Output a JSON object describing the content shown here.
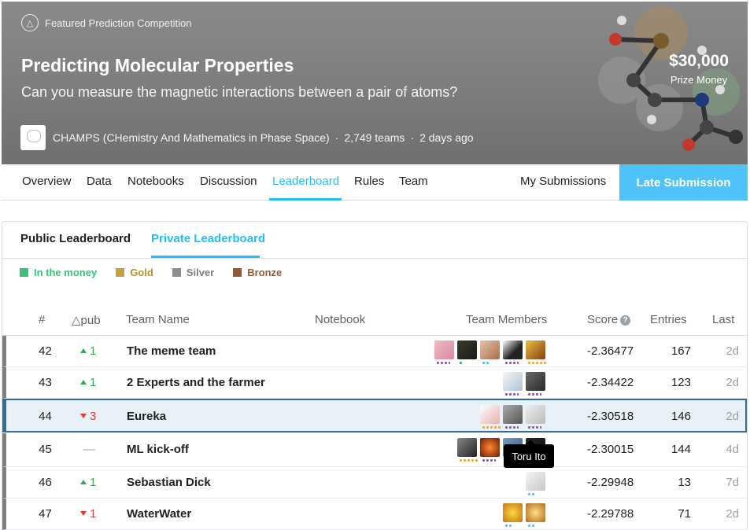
{
  "hero": {
    "label": "Featured Prediction Competition",
    "title": "Predicting Molecular Properties",
    "subtitle": "Can you measure the magnetic interactions between a pair of atoms?",
    "host": "CHAMPS (CHemistry And Mathematics in Phase Space)",
    "teams": "2,749 teams",
    "time": "2 days ago",
    "separator": "·",
    "prize_amount": "$30,000",
    "prize_label": "Prize Money"
  },
  "tabs": [
    "Overview",
    "Data",
    "Notebooks",
    "Discussion",
    "Leaderboard",
    "Rules",
    "Team"
  ],
  "my_submissions": "My Submissions",
  "late_submission": "Late Submission",
  "leaderboard": {
    "public_tab": "Public Leaderboard",
    "private_tab": "Private Leaderboard",
    "legend": [
      {
        "label": "In the money",
        "color": "#3cc07a"
      },
      {
        "label": "Gold",
        "color": "#c9a03c"
      },
      {
        "label": "Silver",
        "color": "#8e8e8e"
      },
      {
        "label": "Bronze",
        "color": "#8d5a3b"
      }
    ],
    "columns": {
      "rank": "#",
      "delta": "△pub",
      "team": "Team Name",
      "notebook": "Notebook",
      "members": "Team Members",
      "score": "Score",
      "entries": "Entries",
      "last": "Last"
    },
    "rows": [
      {
        "rank": "42",
        "delta": "1",
        "direction": "up",
        "team": "The meme team",
        "score": "-2.36477",
        "entries": "167",
        "last": "2d"
      },
      {
        "rank": "43",
        "delta": "1",
        "direction": "up",
        "team": "2 Experts and the farmer",
        "score": "-2.34422",
        "entries": "123",
        "last": "2d"
      },
      {
        "rank": "44",
        "delta": "3",
        "direction": "down",
        "team": "Eureka",
        "score": "-2.30518",
        "entries": "146",
        "last": "2d"
      },
      {
        "rank": "45",
        "delta": "—",
        "direction": "none",
        "team": "ML kick-off",
        "score": "-2.30015",
        "entries": "144",
        "last": "4d"
      },
      {
        "rank": "46",
        "delta": "1",
        "direction": "up",
        "team": "Sebastian Dick",
        "score": "-2.29948",
        "entries": "13",
        "last": "7d"
      },
      {
        "rank": "47",
        "delta": "1",
        "direction": "down",
        "team": "WaterWater",
        "score": "-2.29788",
        "entries": "71",
        "last": "2d"
      }
    ]
  },
  "tooltip": "Toru Ito",
  "help_glyph": "?"
}
